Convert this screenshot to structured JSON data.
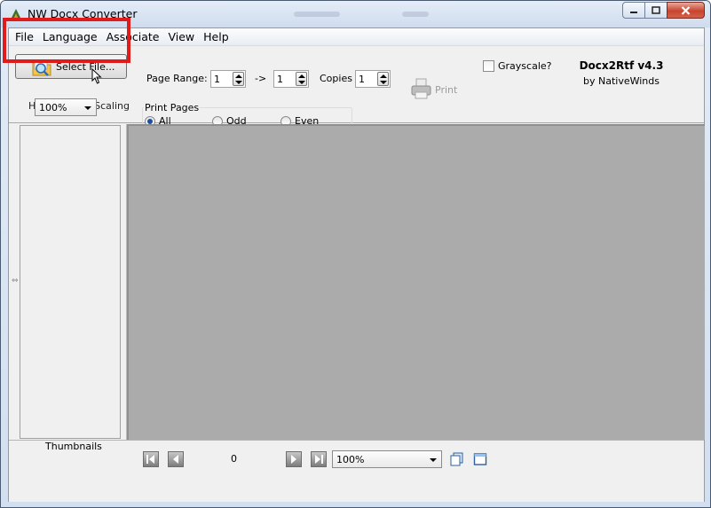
{
  "window": {
    "title": "NW Docx Converter"
  },
  "menu": {
    "items": [
      "File",
      "Language",
      "Associate",
      "View",
      "Help"
    ]
  },
  "toolbar": {
    "select_file_label": "Select File...",
    "html_import_scaling_label": "HTML Import Scaling",
    "scaling_value": "100%",
    "page_range_label": "Page Range:",
    "page_from": "1",
    "arrow_text": "->",
    "page_to": "1",
    "copies_label": "Copies",
    "copies_value": "1",
    "print_label": "Print",
    "grayscale_label": "Grayscale?",
    "print_pages_label": "Print Pages",
    "print_pages_options": [
      "All",
      "Odd",
      "Even"
    ],
    "print_pages_selected": "All"
  },
  "brand": {
    "name": "Docx2Rtf v4.3",
    "by": "by NativeWinds"
  },
  "thumbnails": {
    "label": "Thumbnails"
  },
  "navigation": {
    "page_number": "0",
    "zoom_value": "100%"
  },
  "colors": {
    "highlight": "#e11a1a",
    "document_background": "#ababab",
    "close_button": "#c7452f"
  }
}
